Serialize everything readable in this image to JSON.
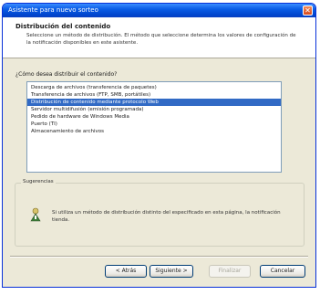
{
  "window": {
    "title": "Asistente para nuevo sorteo",
    "close_glyph": "✕"
  },
  "header": {
    "title": "Distribución del contenido",
    "description": "Seleccione un método de distribución. El método que seleccione determina los valores de configuración de la notificación disponibles en este asistente."
  },
  "question": "¿Cómo desea distribuir el contenido?",
  "list": {
    "items": [
      {
        "label": "Descarga de archivos (transferencia de paquetes)",
        "selected": false
      },
      {
        "label": "Transferencia de archivos (FTP, SMB, portátiles)",
        "selected": false
      },
      {
        "label": "Distribución de contenido mediante protocolo Web",
        "selected": true
      },
      {
        "label": "Servidor multidifusión (emisión programada)",
        "selected": false
      },
      {
        "label": "Pedido de hardware de Windows Media",
        "selected": false
      },
      {
        "label": "Puerto (TI)",
        "selected": false
      },
      {
        "label": "Almacenamiento de archivos",
        "selected": false
      }
    ]
  },
  "hint": {
    "legend": "Sugerencias",
    "icon": "wizard-hint-icon",
    "text": "Si utiliza un método de distribución distinto del especificado en esta página, la notificación tienda."
  },
  "buttons": {
    "back": "< Atrás",
    "next": "Siguiente >",
    "finish": "Finalizar",
    "cancel": "Cancelar"
  },
  "colors": {
    "titlebar": "#0a5ce6",
    "selection": "#316ac5",
    "dialog_bg": "#ece9d8"
  }
}
